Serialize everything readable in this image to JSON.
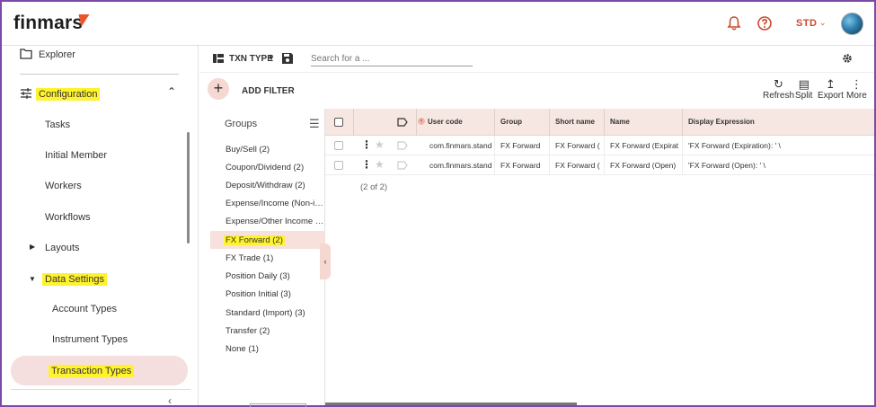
{
  "header": {
    "logo": "finmars",
    "user_label": "STD"
  },
  "sidebar": {
    "explorer": "Explorer",
    "configuration": "Configuration",
    "items": [
      {
        "label": "Tasks"
      },
      {
        "label": "Initial Member"
      },
      {
        "label": "Workers"
      },
      {
        "label": "Workflows"
      },
      {
        "label": "Layouts"
      },
      {
        "label": "Data Settings"
      },
      {
        "label": "Account Types"
      },
      {
        "label": "Instrument Types"
      },
      {
        "label": "Transaction Types"
      }
    ]
  },
  "toolbar": {
    "entity": "TXN TYPE",
    "search_placeholder": "Search for a ...",
    "add_filter": "ADD FILTER",
    "refresh": "Refresh",
    "split": "Split",
    "export": "Export",
    "more": "More"
  },
  "groups": {
    "title": "Groups",
    "items": [
      "Buy/Sell (2)",
      "Coupon/Dividend (2)",
      "Deposit/Withdraw (2)",
      "Expense/Income (Non-instr...",
      "Expense/Other Income (Ins...",
      "FX Forward (2)",
      "FX Trade (1)",
      "Position Daily (3)",
      "Position Initial (3)",
      "Standard (Import) (3)",
      "Transfer (2)",
      "None (1)"
    ]
  },
  "table": {
    "columns": [
      "User code",
      "Group",
      "Short name",
      "Name",
      "Display Expression"
    ],
    "rows": [
      [
        "com.finmars.stand",
        "FX Forward",
        "FX Forward (",
        "FX Forward (Expirat",
        "'FX Forward (Expiration): ' \\"
      ],
      [
        "com.finmars.stand",
        "FX Forward",
        "FX Forward (",
        "FX Forward (Open)",
        "'FX Forward (Open): ' \\"
      ]
    ],
    "count": "(2 of 2)"
  },
  "colors": {
    "accent": "#c84a2e",
    "highlight": "#fff22e",
    "active_bg": "#f5dede"
  }
}
